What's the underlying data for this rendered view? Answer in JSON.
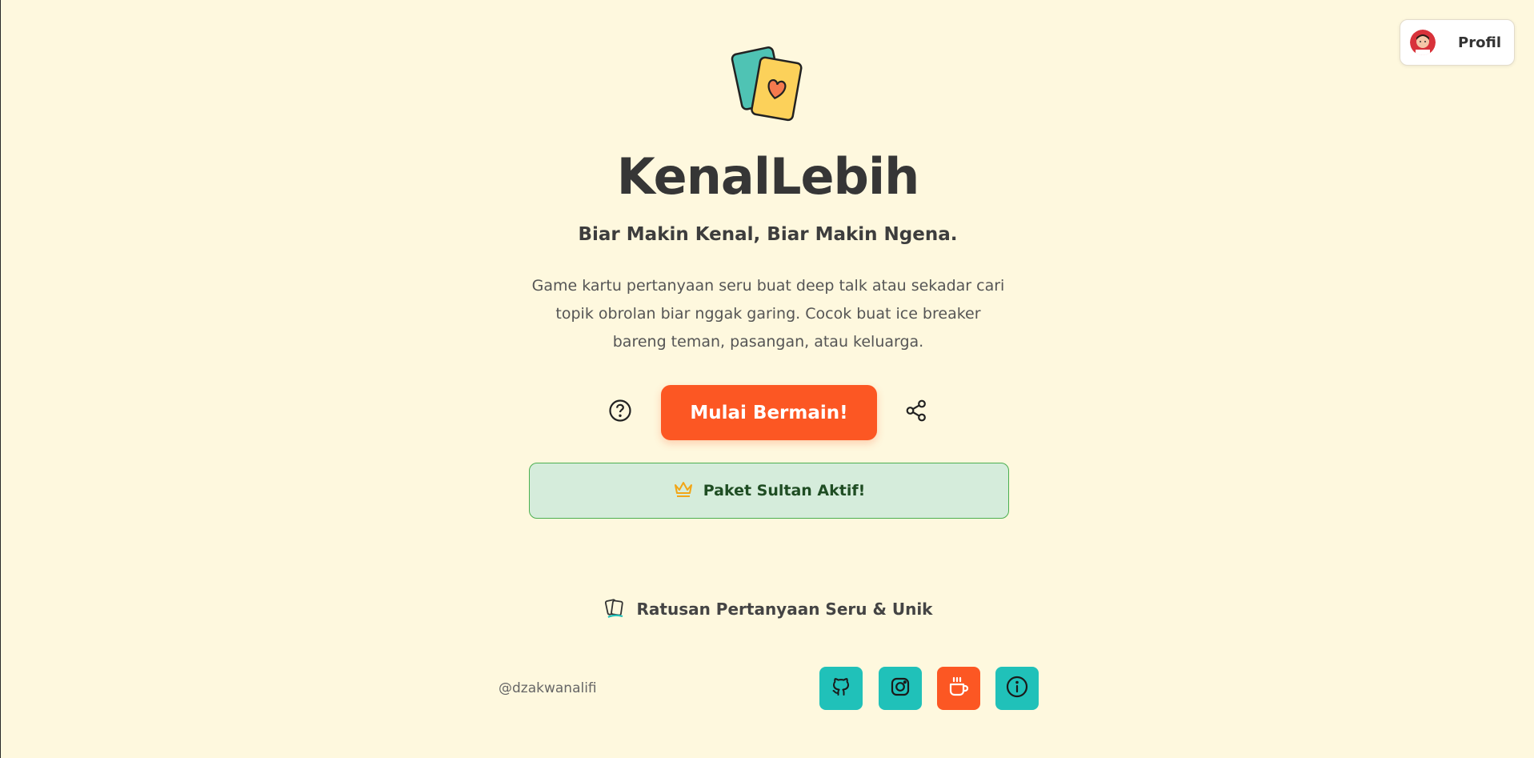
{
  "header": {
    "profile_label": "Profil",
    "avatar_icon": "user-avatar"
  },
  "hero": {
    "logo_icon": "playing-cards-heart-icon",
    "title": "KenalLebih",
    "subtitle": "Biar Makin Kenal, Biar Makin Ngena.",
    "description": "Game kartu pertanyaan seru buat deep talk atau sekadar cari topik obrolan biar nggak garing. Cocok buat ice breaker bareng teman, pasangan, atau keluarga."
  },
  "actions": {
    "help_icon": "help-circle-icon",
    "start_label": "Mulai Bermain!",
    "share_icon": "share-icon"
  },
  "status": {
    "icon": "crown-icon",
    "label": "Paket Sultan Aktif!"
  },
  "feature": {
    "icon": "cards-icon",
    "label": "Ratusan Pertanyaan Seru & Unik"
  },
  "footer": {
    "handle": "@dzakwanalifi",
    "links": [
      {
        "icon": "github-icon"
      },
      {
        "icon": "instagram-icon"
      },
      {
        "icon": "coffee-icon"
      },
      {
        "icon": "info-icon"
      }
    ]
  },
  "colors": {
    "background": "#fef8de",
    "primary": "#fc5723",
    "teal": "#20c1b9",
    "success_bg": "#d5ecdb",
    "success_border": "#4caf50",
    "crown": "#f2a516"
  }
}
